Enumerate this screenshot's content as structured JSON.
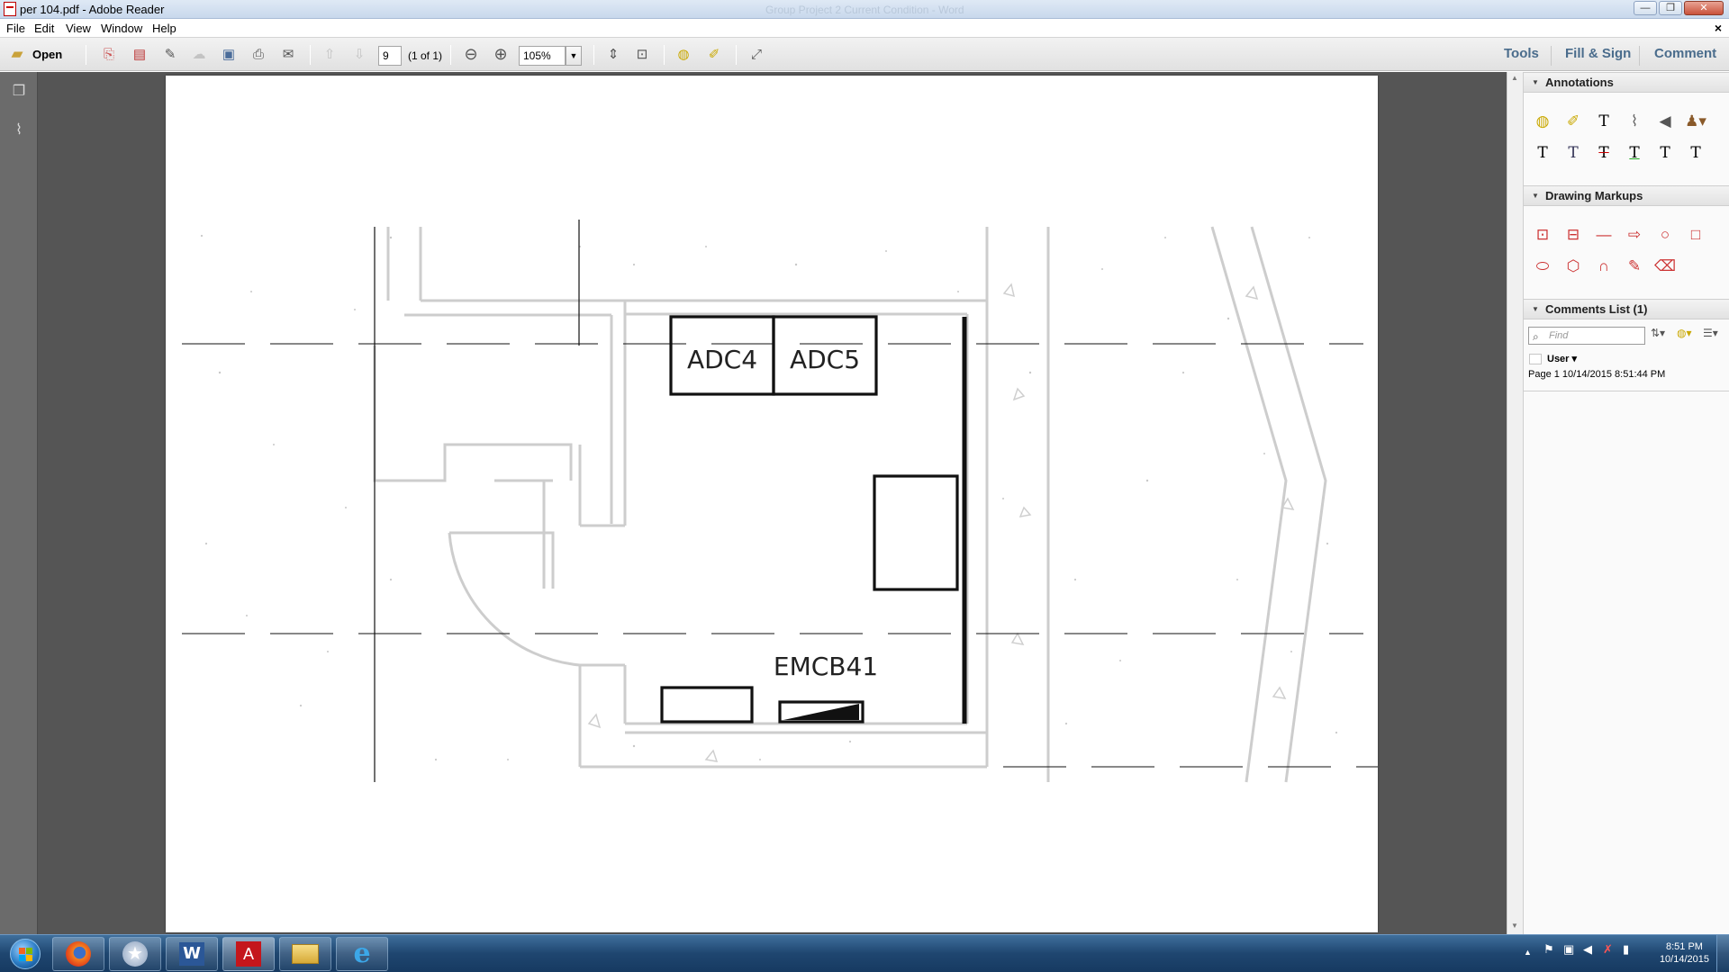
{
  "window": {
    "title": "per 104.pdf - Adobe Reader",
    "ghost_title": "Group Project 2 Current Condition - Word",
    "buttons": {
      "minimize": "—",
      "maximize": "❐",
      "close": "✕"
    }
  },
  "menu": {
    "items": [
      "File",
      "Edit",
      "View",
      "Window",
      "Help"
    ],
    "doc_close": "×"
  },
  "toolbar": {
    "open_label": "Open",
    "page_number": "9",
    "page_of": "(1 of 1)",
    "zoom": "105%",
    "icons": [
      "open-icon",
      "create-pdf-icon",
      "export-pdf-icon",
      "edit-pdf-icon",
      "cloud-upload-icon",
      "save-icon",
      "print-icon",
      "email-icon",
      "page-up-icon",
      "page-down-icon",
      "zoom-out-icon",
      "zoom-in-icon",
      "fit-page-icon",
      "fit-width-icon",
      "sticky-note-icon",
      "highlight-icon",
      "read-mode-icon"
    ],
    "right_links": [
      "Tools",
      "Fill & Sign",
      "Comment"
    ]
  },
  "leftnav": {
    "icons": [
      "page-thumbnails-icon",
      "attachments-icon"
    ]
  },
  "drawing": {
    "labels": {
      "adc4": "ADC4",
      "adc5": "ADC5",
      "emcb": "EMCB41"
    },
    "colors": {
      "line": "#000000",
      "faint": "#c8c8c8",
      "page": "#ffffff"
    }
  },
  "panel": {
    "annotations_header": "Annotations",
    "annotation_tools": [
      "sticky-note-icon",
      "highlight-text-icon",
      "add-text-icon",
      "attach-file-icon",
      "record-audio-icon",
      "stamp-icon",
      "insert-text-icon",
      "replace-text-icon",
      "strikethrough-icon",
      "underline-icon",
      "add-note-to-text-icon",
      "text-correction-icon"
    ],
    "drawing_header": "Drawing Markups",
    "drawing_tools": [
      "text-box-icon",
      "callout-icon",
      "line-icon",
      "arrow-icon",
      "oval-icon",
      "rectangle-icon",
      "cloud-icon",
      "polygon-icon",
      "connected-lines-icon",
      "pencil-icon",
      "eraser-icon"
    ],
    "comments_header": "Comments List (1)",
    "find_placeholder": "Find",
    "comment": {
      "user": "User ▾",
      "meta": "Page 1  10/14/2015 8:51:44 PM"
    }
  },
  "taskbar": {
    "apps": [
      "firefox-icon",
      "app-star-icon",
      "word-icon",
      "adobe-reader-icon",
      "file-explorer-icon",
      "internet-explorer-icon"
    ],
    "tray_icons": [
      "tray-expand-icon",
      "action-center-icon",
      "network-icon",
      "volume-icon",
      "flag-icon",
      "signal-icon"
    ],
    "time": "8:51 PM",
    "date": "10/14/2015"
  }
}
